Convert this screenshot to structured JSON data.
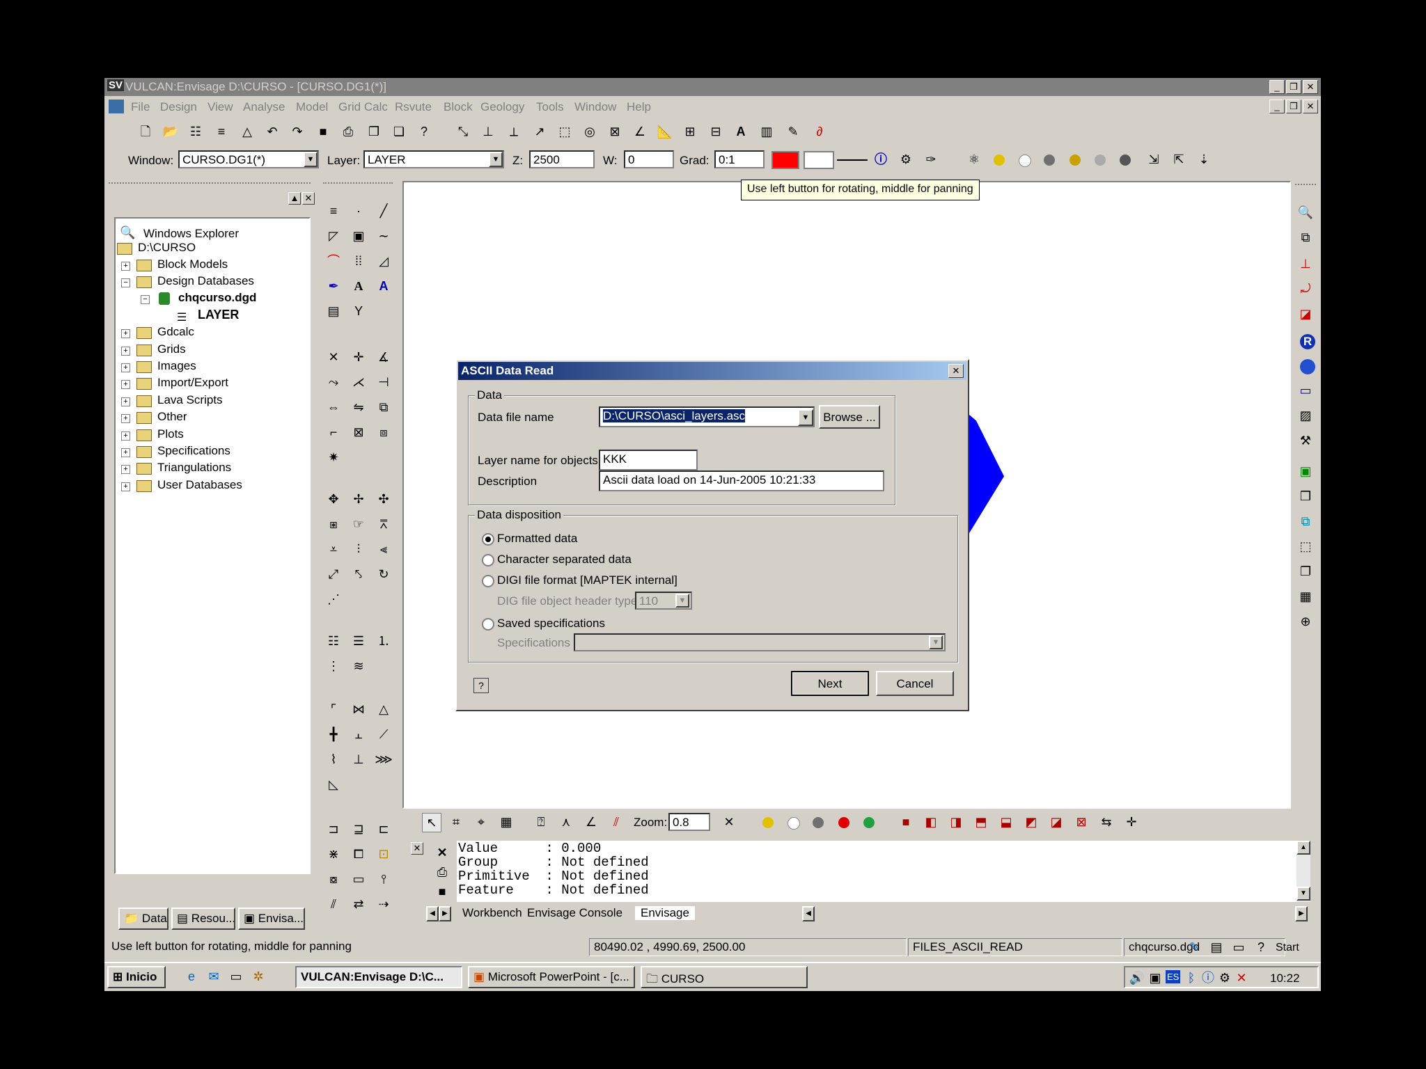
{
  "window": {
    "title": "VULCAN:Envisage  D:\\CURSO - [CURSO.DG1(*)]",
    "app_icon": "SV"
  },
  "menu": [
    "File",
    "Design",
    "View",
    "Analyse",
    "Model",
    "Grid Calc",
    "Rsvute",
    "Block",
    "Geology",
    "Tools",
    "Window",
    "Help"
  ],
  "toolbar2": {
    "window_label": "Window:",
    "window_value": "CURSO.DG1(*)",
    "layer_label": "Layer:",
    "layer_value": "LAYER",
    "z_label": "Z:",
    "z_value": "2500",
    "w_label": "W:",
    "w_value": "0",
    "grad_label": "Grad:",
    "grad_value": "0:1",
    "color": "#ff0000"
  },
  "tooltip": "Use left button for rotating, middle for panning",
  "explorer": {
    "title": "Windows Explorer",
    "root": "D:\\CURSO",
    "items": [
      "Block Models",
      "Design Databases",
      "chqcurso.dgd",
      "LAYER",
      "Gdcalc",
      "Grids",
      "Images",
      "Import/Export",
      "Lava Scripts",
      "Other",
      "Plots",
      "Specifications",
      "Triangulations",
      "User Databases"
    ],
    "tabs": [
      "Data",
      "Resou...",
      "Envisa..."
    ]
  },
  "dialog": {
    "title": "ASCII Data Read",
    "data_group": "Data",
    "file_label": "Data file name",
    "file_value": "D:\\CURSO\\asci_layers.asc",
    "browse": "Browse ...",
    "layer_label": "Layer name for objects",
    "layer_value": "KKK",
    "desc_label": "Description",
    "desc_value": "Ascii data load on 14-Jun-2005 10:21:33",
    "disposition_group": "Data disposition",
    "options": [
      "Formatted data",
      "Character separated data",
      "DIGI file format [MAPTEK internal]",
      "Saved specifications"
    ],
    "dig_label": "DIG file object header type",
    "dig_value": "110",
    "spec_label": "Specifications",
    "next": "Next",
    "cancel": "Cancel"
  },
  "bottom_toolbar": {
    "zoom_label": "Zoom:",
    "zoom_value": "0.8"
  },
  "console": {
    "lines": [
      "Value      : 0.000",
      "Group      : Not defined",
      "Primitive  : Not defined",
      "Feature    : Not defined"
    ],
    "tabs": [
      "Workbench",
      "Envisage Console",
      "Envisage"
    ]
  },
  "status": {
    "message": "Use left button for rotating, middle for panning",
    "coords": "80490.02 , 4990.69, 2500.00",
    "command": "FILES_ASCII_READ",
    "file": "chqcurso.dgd",
    "start": "Start"
  },
  "taskbar": {
    "start": "Inicio",
    "tasks": [
      "VULCAN:Envisage  D:\\C...",
      "Microsoft PowerPoint - [c...",
      "CURSO"
    ],
    "tray_lang": "ES",
    "time": "10:22"
  },
  "colors": {
    "titlebar_active": "#0a246a",
    "shape_blue": "#0000ff",
    "red_swatch": "#ff0000"
  }
}
